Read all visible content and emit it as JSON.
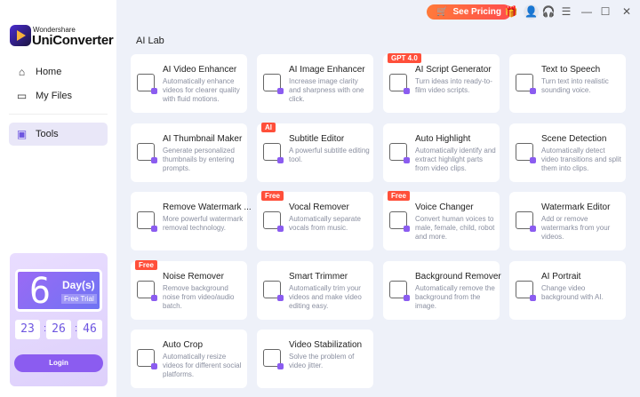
{
  "app": {
    "brand_small": "Wondershare",
    "brand_name": "UniConverter"
  },
  "nav": [
    {
      "label": "Home",
      "icon": "home-icon"
    },
    {
      "label": "My Files",
      "icon": "folder-icon"
    },
    {
      "label": "Tools",
      "icon": "tools-icon"
    }
  ],
  "trial": {
    "days": "6",
    "days_label": "Day(s)",
    "trial_label": "Free Trial",
    "hours": "23",
    "minutes": "26",
    "seconds": "46",
    "login": "Login"
  },
  "topbar": {
    "pricing": "See Pricing"
  },
  "section_title": "AI Lab",
  "tools": [
    {
      "title": "AI Video Enhancer",
      "desc": "Automatically enhance videos for clearer quality with fluid motions.",
      "badge": ""
    },
    {
      "title": "AI Image Enhancer",
      "desc": "Increase image clarity and sharpness with one click.",
      "badge": ""
    },
    {
      "title": "AI Script Generator",
      "desc": "Turn ideas into ready-to-film video scripts.",
      "badge": "GPT 4.0"
    },
    {
      "title": "Text to Speech",
      "desc": "Turn text into realistic sounding voice.",
      "badge": ""
    },
    {
      "title": "AI Thumbnail Maker",
      "desc": "Generate personalized thumbnails by entering prompts.",
      "badge": ""
    },
    {
      "title": "Subtitle Editor",
      "desc": "A powerful subtitle editing tool.",
      "badge": "AI"
    },
    {
      "title": "Auto Highlight",
      "desc": "Automatically identify and extract highlight parts from video clips.",
      "badge": ""
    },
    {
      "title": "Scene Detection",
      "desc": "Automatically detect video transitions and split them into clips.",
      "badge": ""
    },
    {
      "title": "Remove Watermark ...",
      "desc": "More powerful watermark removal technology.",
      "badge": ""
    },
    {
      "title": "Vocal Remover",
      "desc": "Automatically separate vocals from music.",
      "badge": "Free"
    },
    {
      "title": "Voice Changer",
      "desc": "Convert human voices to male, female, child, robot and more.",
      "badge": "Free"
    },
    {
      "title": "Watermark Editor",
      "desc": "Add or remove watermarks from your videos.",
      "badge": ""
    },
    {
      "title": "Noise Remover",
      "desc": "Remove background noise from video/audio batch.",
      "badge": "Free"
    },
    {
      "title": "Smart Trimmer",
      "desc": "Automatically trim your videos and make video editing easy.",
      "badge": ""
    },
    {
      "title": "Background Remover",
      "desc": "Automatically remove the background from the image.",
      "badge": ""
    },
    {
      "title": "AI Portrait",
      "desc": "Change video background with AI.",
      "badge": ""
    },
    {
      "title": "Auto Crop",
      "desc": "Automatically resize videos for different social platforms.",
      "badge": ""
    },
    {
      "title": "Video Stabilization",
      "desc": "Solve the problem of video jitter.",
      "badge": ""
    }
  ]
}
